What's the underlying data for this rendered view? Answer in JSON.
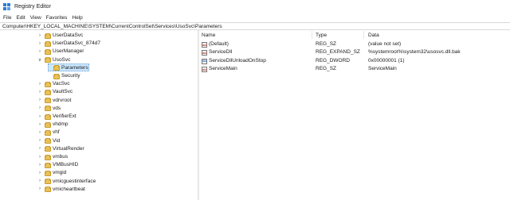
{
  "window": {
    "title": "Registry Editor"
  },
  "menu": [
    "File",
    "Edit",
    "View",
    "Favorites",
    "Help"
  ],
  "address": "Computer\\HKEY_LOCAL_MACHINE\\SYSTEM\\CurrentControlSet\\Services\\UsoSvc\\Parameters",
  "tree": [
    {
      "label": "UserDataSvc",
      "depth": 0,
      "state": "collapsed"
    },
    {
      "label": "UserDataSvc_874d7",
      "depth": 0,
      "state": "collapsed"
    },
    {
      "label": "UserManager",
      "depth": 0,
      "state": "collapsed"
    },
    {
      "label": "UsoSvc",
      "depth": 0,
      "state": "expanded"
    },
    {
      "label": "Parameters",
      "depth": 1,
      "state": "leaf",
      "selected": true
    },
    {
      "label": "Security",
      "depth": 1,
      "state": "leaf"
    },
    {
      "label": "VacSvc",
      "depth": 0,
      "state": "collapsed"
    },
    {
      "label": "VaultSvc",
      "depth": 0,
      "state": "collapsed"
    },
    {
      "label": "vdrvroot",
      "depth": 0,
      "state": "collapsed"
    },
    {
      "label": "vds",
      "depth": 0,
      "state": "collapsed"
    },
    {
      "label": "VerifierExt",
      "depth": 0,
      "state": "collapsed"
    },
    {
      "label": "vhdmp",
      "depth": 0,
      "state": "collapsed"
    },
    {
      "label": "vhf",
      "depth": 0,
      "state": "collapsed"
    },
    {
      "label": "Vid",
      "depth": 0,
      "state": "collapsed"
    },
    {
      "label": "VirtualRender",
      "depth": 0,
      "state": "collapsed"
    },
    {
      "label": "vmbus",
      "depth": 0,
      "state": "collapsed"
    },
    {
      "label": "VMBusHID",
      "depth": 0,
      "state": "collapsed"
    },
    {
      "label": "vmgid",
      "depth": 0,
      "state": "collapsed"
    },
    {
      "label": "vmicguestinterface",
      "depth": 0,
      "state": "collapsed"
    },
    {
      "label": "vmicheartbeat",
      "depth": 0,
      "state": "collapsed"
    }
  ],
  "columns": [
    "Name",
    "Type",
    "Data"
  ],
  "values": [
    {
      "icon": "string-value-icon",
      "name": "(Default)",
      "type": "REG_SZ",
      "data": "(value not set)"
    },
    {
      "icon": "string-value-icon",
      "name": "ServiceDll",
      "type": "REG_EXPAND_SZ",
      "data": "%systemroot%\\system32\\usosvc.dll.bak"
    },
    {
      "icon": "binary-value-icon",
      "name": "ServiceDllUnloadOnStop",
      "type": "REG_DWORD",
      "data": "0x00000001 (1)"
    },
    {
      "icon": "string-value-icon",
      "name": "ServiceMain",
      "type": "REG_SZ",
      "data": "ServiceMain"
    }
  ]
}
